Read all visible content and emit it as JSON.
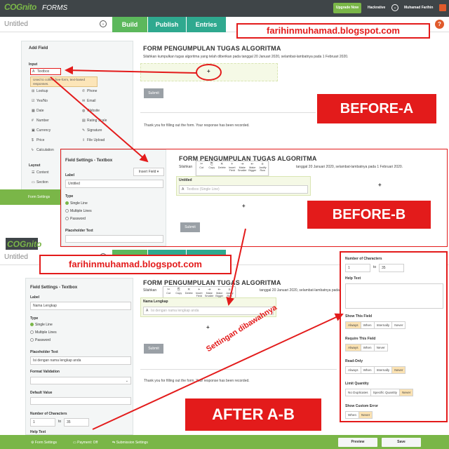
{
  "app": {
    "logo": "COGnito",
    "product": "FORMS",
    "upgrade_label": "Upgrade Now",
    "org_name": "Hackrative",
    "user_name": "Muhamad Farihin",
    "form_name": "Untitled",
    "tabs": {
      "build": "Build",
      "publish": "Publish",
      "entries": "Entries"
    }
  },
  "watermark": "farihinmuhamad.blogspot.com",
  "labels": {
    "before_a": "BEFORE-A",
    "before_b": "BEFORE-B",
    "after": "AFTER A-B",
    "note": "Settingan dibawahnya"
  },
  "add_field": {
    "title": "Add Field",
    "input_header": "Input",
    "left_items": [
      "Textbox",
      "Lookup",
      "Yes/No",
      "Date",
      "Number",
      "Currency",
      "Price",
      "Calculation"
    ],
    "right_items": [
      "Phone",
      "Email",
      "Website",
      "Rating Scale",
      "Signature",
      "File Upload"
    ],
    "tooltip": "Used to collect free-form, text-based responses.",
    "layout_header": "Layout",
    "layout_items": [
      "Content",
      "Section"
    ],
    "form_settings_label": "Form Settings"
  },
  "form": {
    "title": "FORM PENGUMPULAN TUGAS ALGORITMA",
    "description": "Silahkan kumpulkan tugas algoritma yang telah diberikan pada tanggal 20 Januari 2020, selambat-lambatnya pada 1 Februari 2020.",
    "description_b_prefix": "Silahkan",
    "description_b_suffix": "tanggal 20 Januari 2020, selambat-lambatnya pada 1 Februari 2020.",
    "submit_label": "Submit",
    "confirmation": "Thank you for filling out the form. Your response has been recorded.",
    "field_untitled": "Untitled",
    "field_untitled_placeholder": "Textbox (Single Line)",
    "field_name_label": "Nama Lengkap",
    "field_name_placeholder": "Isi dengan nama lengkap anda",
    "plus": "+"
  },
  "toolbar": [
    "Cut",
    "Copy",
    "Delete",
    "Insert Field",
    "Make Smaller",
    "Make Bigger",
    "Justify Row"
  ],
  "settings_b": {
    "title": "Field Settings - Textbox",
    "insert_field": "Insert Field",
    "label_caption": "Label",
    "label_value": "Untitled",
    "type_caption": "Type",
    "types": [
      "Single Line",
      "Multiple Lines",
      "Password"
    ],
    "placeholder_caption": "Placeholder Text"
  },
  "settings_after": {
    "title": "Field Settings - Textbox",
    "label_caption": "Label",
    "label_value": "Nama Lengkap",
    "type_caption": "Type",
    "types": [
      "Single Line",
      "Multiple Lines",
      "Password"
    ],
    "placeholder_caption": "Placeholder Text",
    "placeholder_value": "Isi dengan nama lengkap anda",
    "format_caption": "Format Validation",
    "default_caption": "Default Value",
    "chars_caption": "Number of Characters",
    "chars_min": "1",
    "chars_to": "to",
    "chars_max": "35",
    "help_caption": "Help Text"
  },
  "settings_right": {
    "chars_caption": "Number of Characters",
    "chars_min": "1",
    "chars_to": "to",
    "chars_max": "35",
    "help_caption": "Help Text",
    "show_caption": "Show This Field",
    "show_options": [
      "Always",
      "When",
      "Internally",
      "Never"
    ],
    "require_caption": "Require This Field",
    "require_options": [
      "Always",
      "When",
      "Never"
    ],
    "readonly_caption": "Read-Only",
    "readonly_options": [
      "Always",
      "When",
      "Internally",
      "Never"
    ],
    "limit_caption": "Limit Quantity",
    "limit_options": [
      "No Duplicates",
      "Specific Quantity",
      "Never"
    ],
    "error_caption": "Show Custom Error",
    "error_options": [
      "When",
      "Never"
    ]
  },
  "bottom_bar": {
    "form_settings": "Form Settings",
    "payment": "Payment: Off",
    "submission": "Submission Settings",
    "preview": "Preview",
    "save": "Save"
  },
  "colors": {
    "accent_green": "#7ab648",
    "tab_teal": "#2fa98f",
    "annotation_red": "#e31b1b",
    "topbar": "#3f4548"
  }
}
